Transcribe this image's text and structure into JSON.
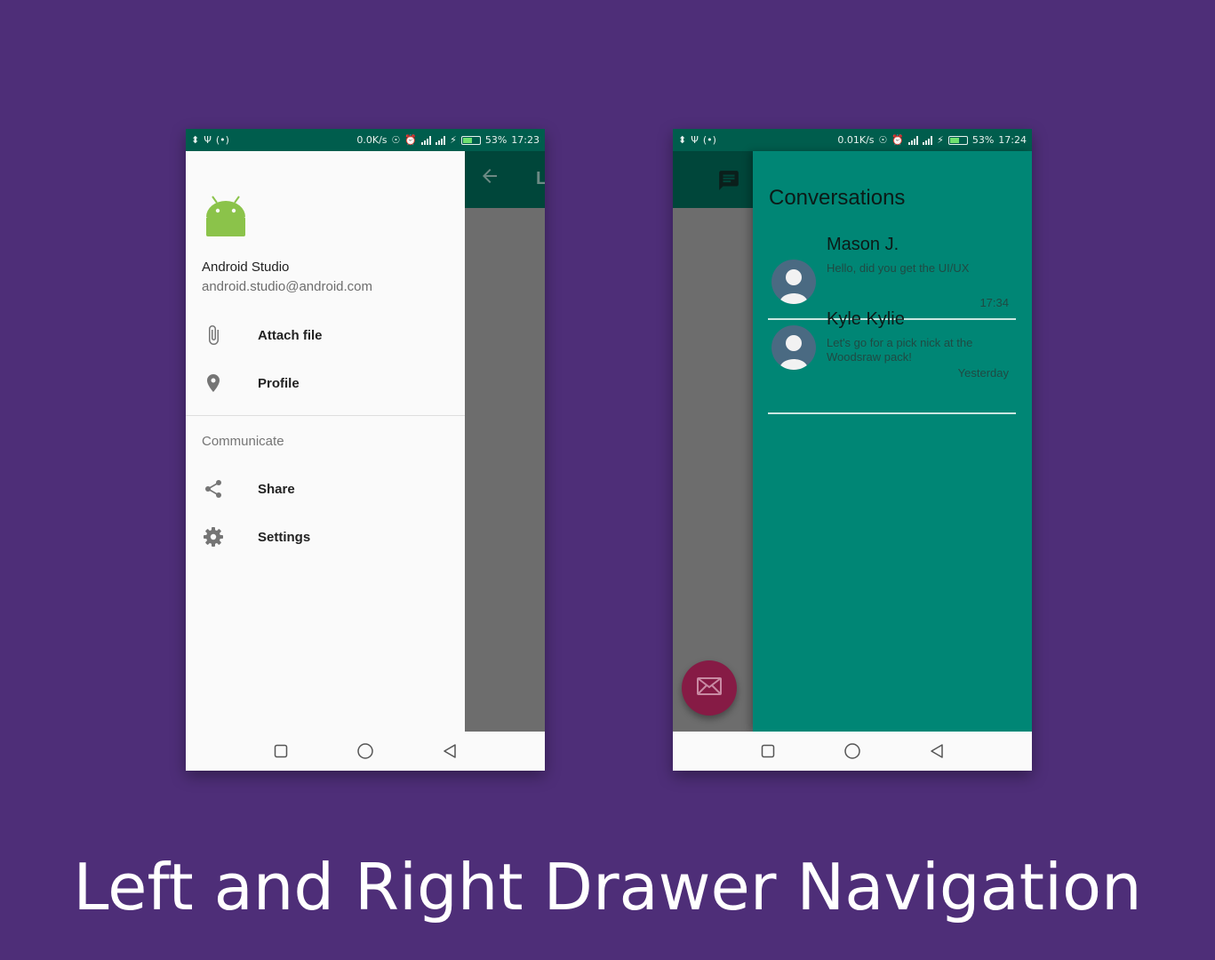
{
  "colors": {
    "background": "#4e2e78",
    "status_bar": "#005d4d",
    "app_bar": "#00463a",
    "drawer_left": "#fafafa",
    "drawer_right": "#008675",
    "fab": "#861b45"
  },
  "left_phone": {
    "status": {
      "speed": "0.0K/s",
      "battery": "53%",
      "time": "17:23"
    },
    "app_bar": {
      "title_fragment": "L",
      "back_icon": "arrow-back-icon"
    },
    "drawer": {
      "account_name": "Android Studio",
      "account_email": "android.studio@android.com",
      "items": [
        {
          "icon": "paperclip-icon",
          "label": "Attach file"
        },
        {
          "icon": "location-pin-icon",
          "label": "Profile"
        }
      ],
      "section_title": "Communicate",
      "section_items": [
        {
          "icon": "share-icon",
          "label": "Share"
        },
        {
          "icon": "gear-icon",
          "label": "Settings"
        }
      ]
    }
  },
  "right_phone": {
    "status": {
      "speed": "0.01K/s",
      "battery": "53%",
      "time": "17:24"
    },
    "drawer": {
      "title": "Conversations",
      "conversations": [
        {
          "name": "Mason J.",
          "message": "Hello, did you get the UI/UX",
          "time": "17:34"
        },
        {
          "name": "Kyle Kylie",
          "message": "Let's go for a pick nick at the Woodsraw pack!",
          "time": "Yesterday"
        }
      ]
    },
    "fab_icon": "mail-icon",
    "app_bar_icon": "chat-icon"
  },
  "caption": "Left and Right Drawer Navigation"
}
